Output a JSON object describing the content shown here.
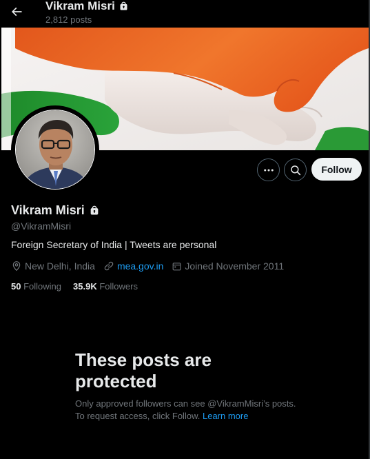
{
  "header": {
    "name": "Vikram Misri",
    "posts_count": "2,812 posts"
  },
  "profile": {
    "name": "Vikram Misri",
    "handle": "@VikramMisri",
    "bio": "Foreign Secretary of India | Tweets are personal",
    "location": "New Delhi, India",
    "website": "mea.gov.in",
    "joined": "Joined November 2011",
    "following_count": "50",
    "following_label": "Following",
    "followers_count": "35.9K",
    "followers_label": "Followers"
  },
  "actions": {
    "follow_label": "Follow"
  },
  "protected": {
    "title": "These posts are protected",
    "body": "Only approved followers can see @VikramMisri’s posts. To request access, click Follow.",
    "learn_more": "Learn more"
  },
  "icons": {
    "back": "back-arrow-icon",
    "lock": "lock-icon",
    "more": "more-icon",
    "search": "search-icon",
    "location": "location-pin-icon",
    "link": "link-icon",
    "calendar": "calendar-icon"
  },
  "colors": {
    "background": "#000000",
    "text_primary": "#e7e9ea",
    "text_secondary": "#71767b",
    "accent_link": "#1d9bf0",
    "follow_button_bg": "#eff3f4",
    "button_border": "#536471"
  }
}
